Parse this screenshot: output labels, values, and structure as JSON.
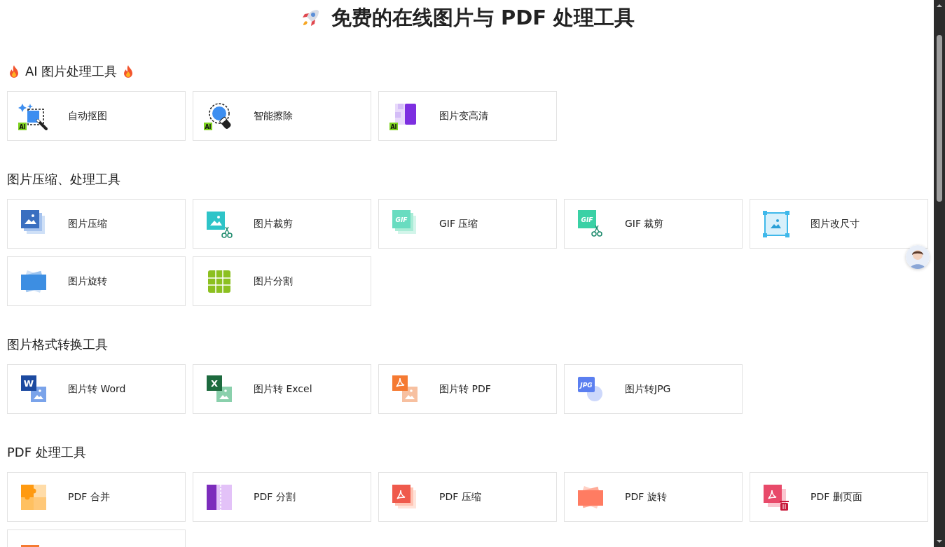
{
  "page_title": "免费的在线图片与 PDF 处理工具",
  "sections": [
    {
      "title": "AI 图片处理工具",
      "hot": true,
      "tools": [
        {
          "label": "自动抠图",
          "icon_label": "AI"
        },
        {
          "label": "智能擦除",
          "icon_label": "AI"
        },
        {
          "label": "图片变高清",
          "icon_label": "AI"
        }
      ]
    },
    {
      "title": "图片压缩、处理工具",
      "hot": false,
      "tools": [
        {
          "label": "图片压缩"
        },
        {
          "label": "图片裁剪"
        },
        {
          "label": "GIF 压缩",
          "icon_label": "GIF"
        },
        {
          "label": "GIF 裁剪",
          "icon_label": "GIF"
        },
        {
          "label": "图片改尺寸"
        },
        {
          "label": "图片旋转"
        },
        {
          "label": "图片分割"
        }
      ]
    },
    {
      "title": "图片格式转换工具",
      "hot": false,
      "tools": [
        {
          "label": "图片转 Word",
          "icon_label": "W"
        },
        {
          "label": "图片转 Excel",
          "icon_label": "X"
        },
        {
          "label": "图片转 PDF"
        },
        {
          "label": "图片转JPG",
          "icon_label": "JPG"
        }
      ]
    },
    {
      "title": "PDF 处理工具",
      "hot": false,
      "tools": [
        {
          "label": "PDF 合并"
        },
        {
          "label": "PDF 分割"
        },
        {
          "label": "PDF 压缩"
        },
        {
          "label": "PDF 旋转"
        },
        {
          "label": "PDF 删页面"
        },
        {
          "cut_off": true
        }
      ]
    }
  ]
}
